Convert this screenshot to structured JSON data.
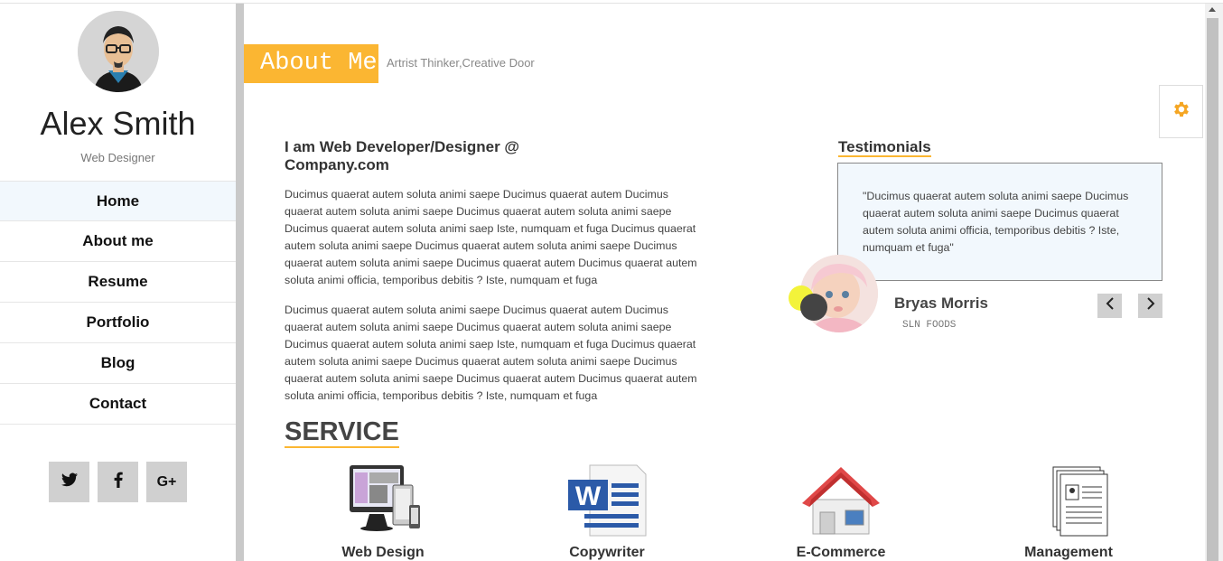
{
  "profile": {
    "name": "Alex Smith",
    "role": "Web Designer"
  },
  "nav": {
    "items": [
      {
        "label": "Home"
      },
      {
        "label": "About me"
      },
      {
        "label": "Resume"
      },
      {
        "label": "Portfolio"
      },
      {
        "label": "Blog"
      },
      {
        "label": "Contact"
      }
    ]
  },
  "social": {
    "twitter": "twitter-icon",
    "facebook": "facebook-icon",
    "googleplus": "G+"
  },
  "about": {
    "tag": "About Me",
    "subtitle": "Artrist Thinker,Creative Door",
    "intro_title": "I am Web Developer/Designer @ Company.com",
    "paragraph1": "Ducimus quaerat autem soluta animi saepe Ducimus quaerat autem Ducimus quaerat autem soluta animi saepe Ducimus quaerat autem soluta animi saepe Ducimus quaerat autem soluta animi saep Iste, numquam et fuga Ducimus quaerat autem soluta animi saepe Ducimus quaerat autem soluta animi saepe Ducimus quaerat autem soluta animi saepe Ducimus quaerat autem Ducimus quaerat autem soluta animi officia, temporibus debitis ? Iste, numquam et fuga",
    "paragraph2": "Ducimus quaerat autem soluta animi saepe Ducimus quaerat autem Ducimus quaerat autem soluta animi saepe Ducimus quaerat autem soluta animi saepe Ducimus quaerat autem soluta animi saep Iste, numquam et fuga Ducimus quaerat autem soluta animi saepe Ducimus quaerat autem soluta animi saepe Ducimus quaerat autem soluta animi saepe Ducimus quaerat autem Ducimus quaerat autem soluta animi officia, temporibus debitis ? Iste, numquam et fuga"
  },
  "testimonials": {
    "heading": "Testimonials",
    "quote": "\"Ducimus quaerat autem soluta animi saepe Ducimus quaerat autem soluta animi saepe Ducimus quaerat autem soluta animi officia, temporibus debitis ? Iste, numquam et fuga\"",
    "name": "Bryas Morris",
    "company": "SLN FOODS"
  },
  "services": {
    "heading": "SERVICE",
    "items": [
      {
        "label": "Web Design",
        "icon": "monitor-devices-icon"
      },
      {
        "label": "Copywriter",
        "icon": "word-document-icon"
      },
      {
        "label": "E-Commerce",
        "icon": "house-icon"
      },
      {
        "label": "Management",
        "icon": "resume-documents-icon"
      }
    ]
  },
  "colors": {
    "accent": "#fbb632",
    "active_nav_bg": "#f2f8fd",
    "social_bg": "#d0d0d0"
  }
}
